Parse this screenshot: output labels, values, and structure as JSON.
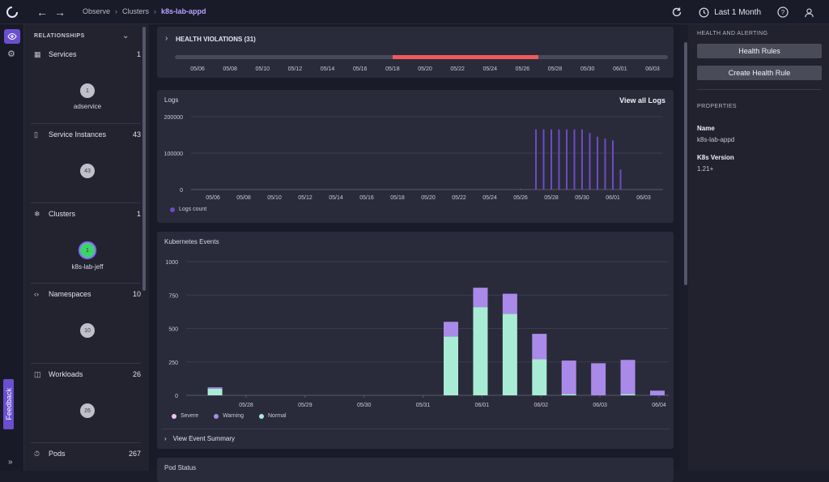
{
  "nav": {
    "breadcrumbs": [
      "Observe",
      "Clusters",
      "k8s-lab-appd"
    ],
    "time_range": "Last 1 Month",
    "feedback_label": "Feedback"
  },
  "relationships": {
    "title": "RELATIONSHIPS",
    "items": [
      {
        "label": "Services",
        "count": "1",
        "bubble": "1",
        "sublabel": "adservice"
      },
      {
        "label": "Service Instances",
        "count": "43",
        "bubble": "43",
        "sublabel": ""
      },
      {
        "label": "Clusters",
        "count": "1",
        "bubble": "1",
        "sublabel": "k8s-lab-jeff"
      },
      {
        "label": "Namespaces",
        "count": "10",
        "bubble": "10",
        "sublabel": ""
      },
      {
        "label": "Workloads",
        "count": "26",
        "bubble": "26",
        "sublabel": ""
      },
      {
        "label": "Pods",
        "count": "267",
        "bubble": "",
        "sublabel": ""
      }
    ]
  },
  "health_violations": {
    "title": "HEALTH VIOLATIONS (31)",
    "ticks": [
      "05/06",
      "05/08",
      "05/10",
      "05/12",
      "05/14",
      "05/16",
      "05/18",
      "05/20",
      "05/22",
      "05/24",
      "05/26",
      "05/28",
      "05/30",
      "06/01",
      "06/03"
    ],
    "violation_range": [
      "05/18",
      "05/27"
    ]
  },
  "logs": {
    "title": "Logs",
    "view_all": "View all Logs",
    "legend": "Logs count",
    "color": "#6e4bc4"
  },
  "events": {
    "title": "Kubernetes Events",
    "view_summary": "View Event Summary",
    "legend": [
      {
        "name": "Severe",
        "color": "#e6c7f5"
      },
      {
        "name": "Warning",
        "color": "#a98ae8"
      },
      {
        "name": "Normal",
        "color": "#a8ecd6"
      }
    ]
  },
  "pod_status": {
    "title": "Pod Status"
  },
  "right_panel": {
    "health_heading": "HEALTH AND ALERTING",
    "health_rules_btn": "Health Rules",
    "create_rule_btn": "Create Health Rule",
    "properties_heading": "PROPERTIES",
    "props": [
      {
        "name": "Name",
        "value": "k8s-lab-appd"
      },
      {
        "name": "K8s Version",
        "value": "1.21+"
      }
    ]
  },
  "chart_data": [
    {
      "type": "bar",
      "title": "Logs",
      "xlabel": "",
      "ylabel": "",
      "ylim": [
        0,
        200000
      ],
      "yticks": [
        0,
        100000,
        200000
      ],
      "xticks": [
        "05/06",
        "05/08",
        "05/10",
        "05/12",
        "05/14",
        "05/16",
        "05/18",
        "05/20",
        "05/22",
        "05/24",
        "05/26",
        "05/28",
        "05/30",
        "06/01",
        "06/03"
      ],
      "series": [
        {
          "name": "Logs count",
          "x": [
            "05/26",
            "05/27",
            "05/27.5",
            "05/28",
            "05/28.5",
            "05/29",
            "05/29.5",
            "05/30",
            "05/30.5",
            "05/31",
            "05/31.5",
            "06/01",
            "06/01.5"
          ],
          "values": [
            2000,
            165000,
            165000,
            165000,
            165000,
            165000,
            165000,
            165000,
            155000,
            145000,
            140000,
            135000,
            55000
          ]
        }
      ],
      "grid": true,
      "legend": "bottom-left"
    },
    {
      "type": "bar",
      "stacked": true,
      "title": "Kubernetes Events",
      "ylim": [
        0,
        1000
      ],
      "yticks": [
        0,
        250,
        500,
        750,
        1000
      ],
      "xticks": [
        "05/28",
        "05/29",
        "05/30",
        "05/31",
        "06/01",
        "06/02",
        "06/03",
        "06/04"
      ],
      "categories": [
        "05/27 12h",
        "05/31 12h",
        "06/01 00h",
        "06/01 12h",
        "06/02 00h",
        "06/02 12h",
        "06/03 00h",
        "06/03 12h",
        "06/04 00h"
      ],
      "series": [
        {
          "name": "Normal",
          "values": [
            50,
            440,
            660,
            610,
            270,
            10,
            0,
            10,
            0
          ]
        },
        {
          "name": "Warning",
          "values": [
            10,
            110,
            145,
            150,
            190,
            250,
            240,
            255,
            35
          ]
        },
        {
          "name": "Severe",
          "values": [
            0,
            0,
            0,
            0,
            0,
            0,
            0,
            0,
            0
          ]
        }
      ],
      "grid": true,
      "legend": "bottom-left"
    }
  ]
}
